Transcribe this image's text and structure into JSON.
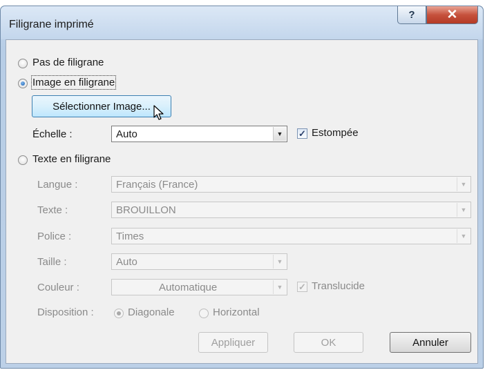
{
  "dialog": {
    "title": "Filigrane imprimé",
    "help_glyph": "?",
    "close_glyph": "✕"
  },
  "options": {
    "none": "Pas de filigrane",
    "picture": "Image en filigrane",
    "text": "Texte en filigrane",
    "selected": "picture"
  },
  "picture": {
    "select_button": "Sélectionner Image...",
    "scale_label": "Échelle :",
    "scale_value": "Auto",
    "washout_label": "Estompée",
    "washout_checked": true
  },
  "text": {
    "language_label": "Langue :",
    "language_value": "Français (France)",
    "text_label": "Texte :",
    "text_value": "BROUILLON",
    "font_label": "Police :",
    "font_value": "Times",
    "size_label": "Taille :",
    "size_value": "Auto",
    "color_label": "Couleur :",
    "color_value": "Automatique",
    "semitransparent_label": "Translucide",
    "semitransparent_checked": true,
    "layout_label": "Disposition :",
    "layout_diagonal": "Diagonale",
    "layout_horizontal": "Horizontal",
    "layout_selected": "diagonal"
  },
  "buttons": {
    "apply": "Appliquer",
    "ok": "OK",
    "cancel": "Annuler"
  },
  "icons": {
    "dropdown": "chevron-down-icon",
    "check": "check-icon",
    "cursor": "mouse-pointer-icon"
  }
}
